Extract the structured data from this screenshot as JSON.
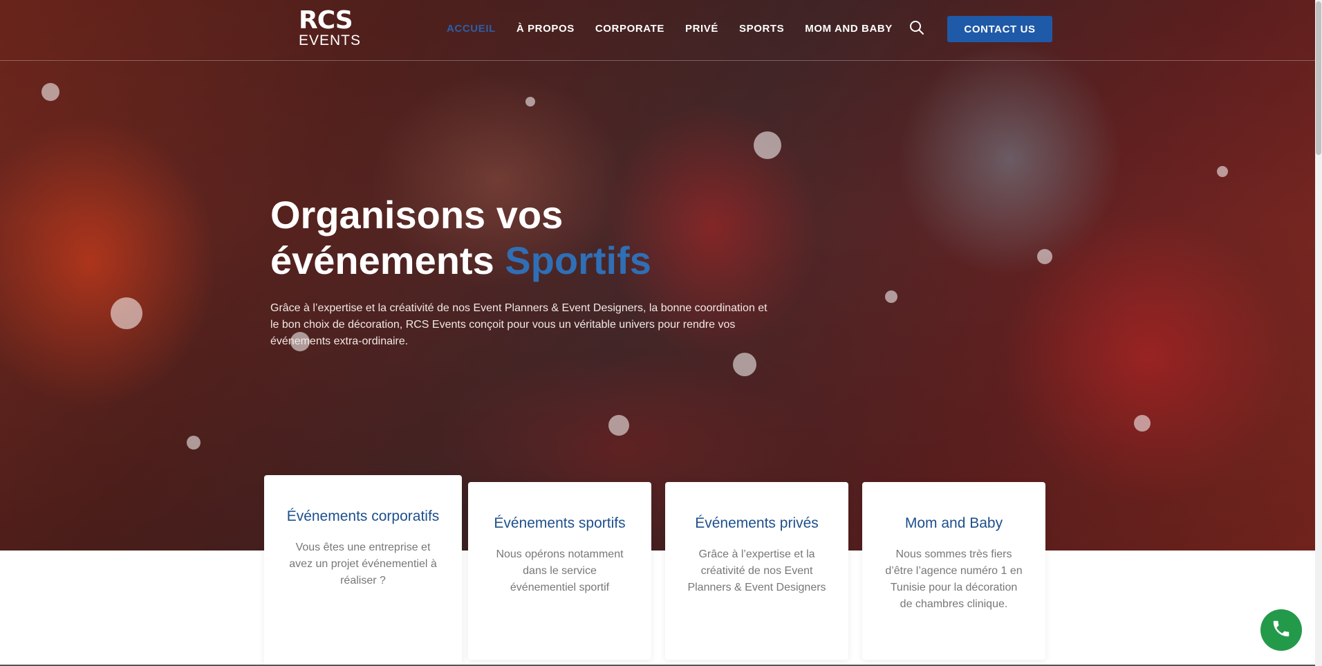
{
  "header": {
    "logo_top": "RCS",
    "logo_bottom": "EVENTS",
    "nav": [
      {
        "label": "ACCUEIL",
        "active": true
      },
      {
        "label": "À PROPOS",
        "active": false
      },
      {
        "label": "CORPORATE",
        "active": false
      },
      {
        "label": "PRIVÉ",
        "active": false
      },
      {
        "label": "SPORTS",
        "active": false
      },
      {
        "label": "MOM AND BABY",
        "active": false
      }
    ],
    "search_icon": "search-icon",
    "contact_label": "CONTACT US"
  },
  "hero": {
    "title_line1": "Organisons vos",
    "title_line2": "événements ",
    "title_accent": "Sportifs",
    "description": "Grâce à l’expertise et la créativité de nos Event Planners & Event Designers,  la bonne coordination et le bon choix de décoration, RCS Events conçoit pour vous un véritable univers pour rendre vos événements extra-ordinaire."
  },
  "cards": [
    {
      "title": "Événements corporatifs",
      "text": "Vous êtes une entreprise et avez un projet événementiel à réaliser ?"
    },
    {
      "title": "Événements sportifs",
      "text": "Nous opérons notamment dans le service événementiel sportif"
    },
    {
      "title": "Événements privés",
      "text": "Grâce à l’expertise et la créativité de nos Event Planners & Event Designers"
    },
    {
      "title": "Mom and Baby",
      "text": "Nous sommes très fiers d’être l’agence numéro 1 en Tunisie pour la décoration de chambres clinique."
    }
  ],
  "colors": {
    "accent_blue": "#2f6fb6",
    "button_blue": "#1f5aa8",
    "card_title": "#1d4f8c",
    "phone_green": "#239a4a"
  },
  "fab_icon": "phone-icon"
}
